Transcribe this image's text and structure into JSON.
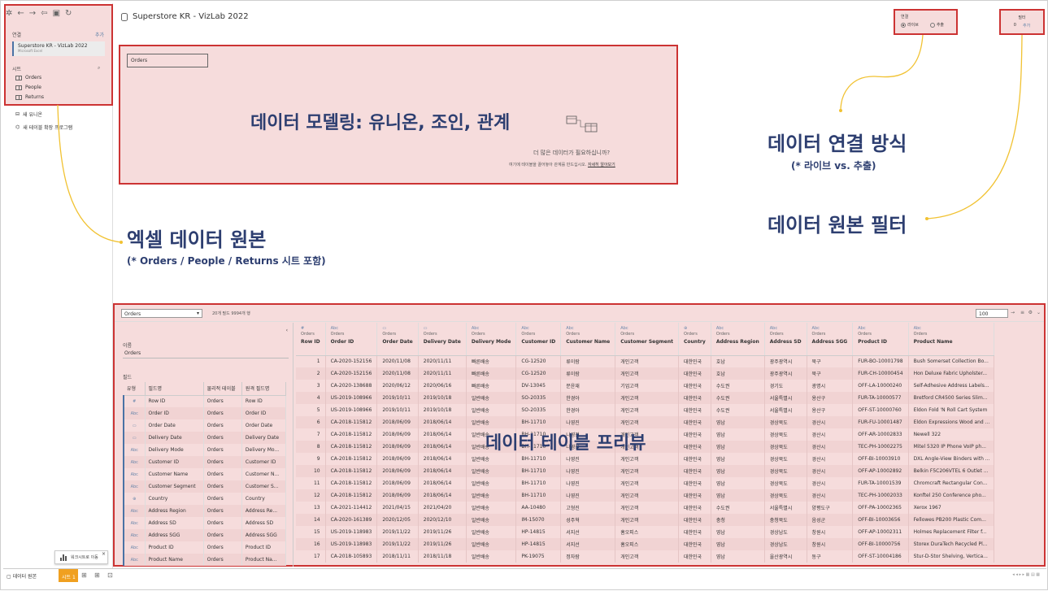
{
  "left": {
    "connections_label": "연결",
    "add_label": "추가",
    "connection": {
      "title": "Superstore KR - VizLab 2022",
      "sub": "Microsoft Excel"
    },
    "sheets_label": "시트",
    "sheets": [
      "Orders",
      "People",
      "Returns"
    ],
    "new_union": "새 유니온",
    "new_ext": "새 테이블 확장 프로그램",
    "tooltip": "워크시트로 이동"
  },
  "header": {
    "title": "Superstore KR - VizLab 2022",
    "connection_label": "연결",
    "live": "라이브",
    "extract": "추출",
    "filter_label": "필터",
    "filter_count": "0",
    "filter_add": "추가"
  },
  "canvas": {
    "table_chip": "Orders",
    "big_label": "데이터 모델링: 유니온, 조인, 관계",
    "more_title": "더 많은 데이터가 필요하십니까?",
    "more_text": "여기에 테이블을 끌어놓아 관계를 만드십시오.",
    "more_link": "자세히 알아보기"
  },
  "annotations": {
    "conn_method": "데이터 연결 방식",
    "conn_sub": "(* 라이브 vs. 추출)",
    "filter": "데이터 원본 필터",
    "excel": "엑셀 데이터 원본",
    "excel_sub": "(* Orders / People / Returns 시트 포함)",
    "preview": "데이터 테이블 프리뷰"
  },
  "data": {
    "table_select": "Orders",
    "info": "20개 필드 9994개 행",
    "rows_select": "100",
    "name_label": "이름",
    "name_value": "Orders",
    "fields_label": "필드",
    "field_headers": [
      "유형",
      "필드명",
      "물리적 테이블",
      "원격 필드명"
    ],
    "fields": [
      [
        "#",
        "Row ID",
        "Orders",
        "Row ID"
      ],
      [
        "Abc",
        "Order ID",
        "Orders",
        "Order ID"
      ],
      [
        "▭",
        "Order Date",
        "Orders",
        "Order Date"
      ],
      [
        "▭",
        "Delivery Date",
        "Orders",
        "Delivery Date"
      ],
      [
        "Abc",
        "Delivery Mode",
        "Orders",
        "Delivery Mo..."
      ],
      [
        "Abc",
        "Customer ID",
        "Orders",
        "Customer ID"
      ],
      [
        "Abc",
        "Customer Name",
        "Orders",
        "Customer N..."
      ],
      [
        "Abc",
        "Customer Segment",
        "Orders",
        "Customer S..."
      ],
      [
        "⊕",
        "Country",
        "Orders",
        "Country"
      ],
      [
        "Abc",
        "Address Region",
        "Orders",
        "Address Re..."
      ],
      [
        "Abc",
        "Address SD",
        "Orders",
        "Address SD"
      ],
      [
        "Abc",
        "Address SGG",
        "Orders",
        "Address SGG"
      ],
      [
        "Abc",
        "Product ID",
        "Orders",
        "Product ID"
      ],
      [
        "Abc",
        "Product Name",
        "Orders",
        "Product Na..."
      ]
    ],
    "columns": [
      {
        "type": "#",
        "name": "Row ID"
      },
      {
        "type": "Abc",
        "name": "Order ID"
      },
      {
        "type": "▭",
        "name": "Order Date"
      },
      {
        "type": "▭",
        "name": "Delivery Date"
      },
      {
        "type": "Abc",
        "name": "Delivery Mode"
      },
      {
        "type": "Abc",
        "name": "Customer ID"
      },
      {
        "type": "Abc",
        "name": "Customer Name"
      },
      {
        "type": "Abc",
        "name": "Customer Segment"
      },
      {
        "type": "⊕",
        "name": "Country"
      },
      {
        "type": "Abc",
        "name": "Address Region"
      },
      {
        "type": "Abc",
        "name": "Address SD"
      },
      {
        "type": "Abc",
        "name": "Address SGG"
      },
      {
        "type": "Abc",
        "name": "Product ID"
      },
      {
        "type": "Abc",
        "name": "Product Name"
      }
    ],
    "source_name": "Orders",
    "rows": [
      [
        "1",
        "CA-2020-152156",
        "2020/11/08",
        "2020/11/11",
        "빠른배송",
        "CG-12520",
        "류이람",
        "개인고객",
        "대한민국",
        "호남",
        "광주광역시",
        "북구",
        "FUR-BO-10001798",
        "Bush Somerset Collection Bo..."
      ],
      [
        "2",
        "CA-2020-152156",
        "2020/11/08",
        "2020/11/11",
        "빠른배송",
        "CG-12520",
        "류이람",
        "개인고객",
        "대한민국",
        "호남",
        "광주광역시",
        "북구",
        "FUR-CH-10000454",
        "Hon Deluxe Fabric Upholster..."
      ],
      [
        "3",
        "CA-2020-138688",
        "2020/06/12",
        "2020/06/16",
        "빠른배송",
        "DV-13045",
        "문윤재",
        "기업고객",
        "대한민국",
        "수도권",
        "경기도",
        "광명시",
        "OFF-LA-10000240",
        "Self-Adhesive Address Labels..."
      ],
      [
        "4",
        "US-2019-108966",
        "2019/10/11",
        "2019/10/18",
        "일반배송",
        "SO-20335",
        "한경아",
        "개인고객",
        "대한민국",
        "수도권",
        "서울특별시",
        "용산구",
        "FUR-TA-10000577",
        "Bretford CR4500 Series Slim..."
      ],
      [
        "5",
        "US-2019-108966",
        "2019/10/11",
        "2019/10/18",
        "일반배송",
        "SO-20335",
        "한경아",
        "개인고객",
        "대한민국",
        "수도권",
        "서울특별시",
        "용산구",
        "OFF-ST-10000760",
        "Eldon Fold 'N Roll Cart System"
      ],
      [
        "6",
        "CA-2018-115812",
        "2018/06/09",
        "2018/06/14",
        "일반배송",
        "BH-11710",
        "나영진",
        "개인고객",
        "대한민국",
        "영남",
        "경상북도",
        "경산시",
        "FUR-FU-10001487",
        "Eldon Expressions Wood and ..."
      ],
      [
        "7",
        "CA-2018-115812",
        "2018/06/09",
        "2018/06/14",
        "일반배송",
        "BH-11710",
        "나영진",
        "개인고객",
        "대한민국",
        "영남",
        "경상북도",
        "경산시",
        "OFF-AR-10002833",
        "Newell 322"
      ],
      [
        "8",
        "CA-2018-115812",
        "2018/06/09",
        "2018/06/14",
        "일반배송",
        "BH-11710",
        "나영진",
        "개인고객",
        "대한민국",
        "영남",
        "경상북도",
        "경산시",
        "TEC-PH-10002275",
        "Mitel 5320 IP Phone VoIP ph..."
      ],
      [
        "9",
        "CA-2018-115812",
        "2018/06/09",
        "2018/06/14",
        "일반배송",
        "BH-11710",
        "나영진",
        "개인고객",
        "대한민국",
        "영남",
        "경상북도",
        "경산시",
        "OFF-BI-10003910",
        "DXL Angle-View Binders with ..."
      ],
      [
        "10",
        "CA-2018-115812",
        "2018/06/09",
        "2018/06/14",
        "일반배송",
        "BH-11710",
        "나영진",
        "개인고객",
        "대한민국",
        "영남",
        "경상북도",
        "경산시",
        "OFF-AP-10002892",
        "Belkin F5C206VTEL 6 Outlet ..."
      ],
      [
        "11",
        "CA-2018-115812",
        "2018/06/09",
        "2018/06/14",
        "일반배송",
        "BH-11710",
        "나영진",
        "개인고객",
        "대한민국",
        "영남",
        "경상북도",
        "경산시",
        "FUR-TA-10001539",
        "Chromcraft Rectangular Con..."
      ],
      [
        "12",
        "CA-2018-115812",
        "2018/06/09",
        "2018/06/14",
        "일반배송",
        "BH-11710",
        "나영진",
        "개인고객",
        "대한민국",
        "영남",
        "경상북도",
        "경산시",
        "TEC-PH-10002033",
        "Konftel 250 Conference pho..."
      ],
      [
        "13",
        "CA-2021-114412",
        "2021/04/15",
        "2021/04/20",
        "일반배송",
        "AA-10480",
        "고형진",
        "개인고객",
        "대한민국",
        "수도권",
        "서울특별시",
        "양평도구",
        "OFF-PA-10002365",
        "Xerox 1967"
      ],
      [
        "14",
        "CA-2020-161389",
        "2020/12/05",
        "2020/12/10",
        "일반배송",
        "IM-15070",
        "성주혁",
        "개인고객",
        "대한민국",
        "충청",
        "충청북도",
        "음성군",
        "OFF-BI-10003656",
        "Fellowes PB200 Plastic Com..."
      ],
      [
        "15",
        "US-2019-118983",
        "2019/11/22",
        "2019/11/26",
        "일반배송",
        "HP-14815",
        "서지선",
        "홈오피스",
        "대한민국",
        "영남",
        "경상남도",
        "창원시",
        "OFF-AP-10002311",
        "Holmes Replacement Filter f..."
      ],
      [
        "16",
        "US-2019-118983",
        "2019/11/22",
        "2019/11/26",
        "일반배송",
        "HP-14815",
        "서지선",
        "홈오피스",
        "대한민국",
        "영남",
        "경상남도",
        "창원시",
        "OFF-BI-10000756",
        "Storex DuraTech Recycled Pl..."
      ],
      [
        "17",
        "CA-2018-105893",
        "2018/11/11",
        "2018/11/18",
        "일반배송",
        "PK-19075",
        "정자람",
        "개인고객",
        "대한민국",
        "영남",
        "울산광역시",
        "동구",
        "OFF-ST-10004186",
        "Stur-D-Stor Shelving, Vertica..."
      ]
    ]
  },
  "bottom": {
    "source": "데이터 원본",
    "sheet1": "시트 1"
  }
}
